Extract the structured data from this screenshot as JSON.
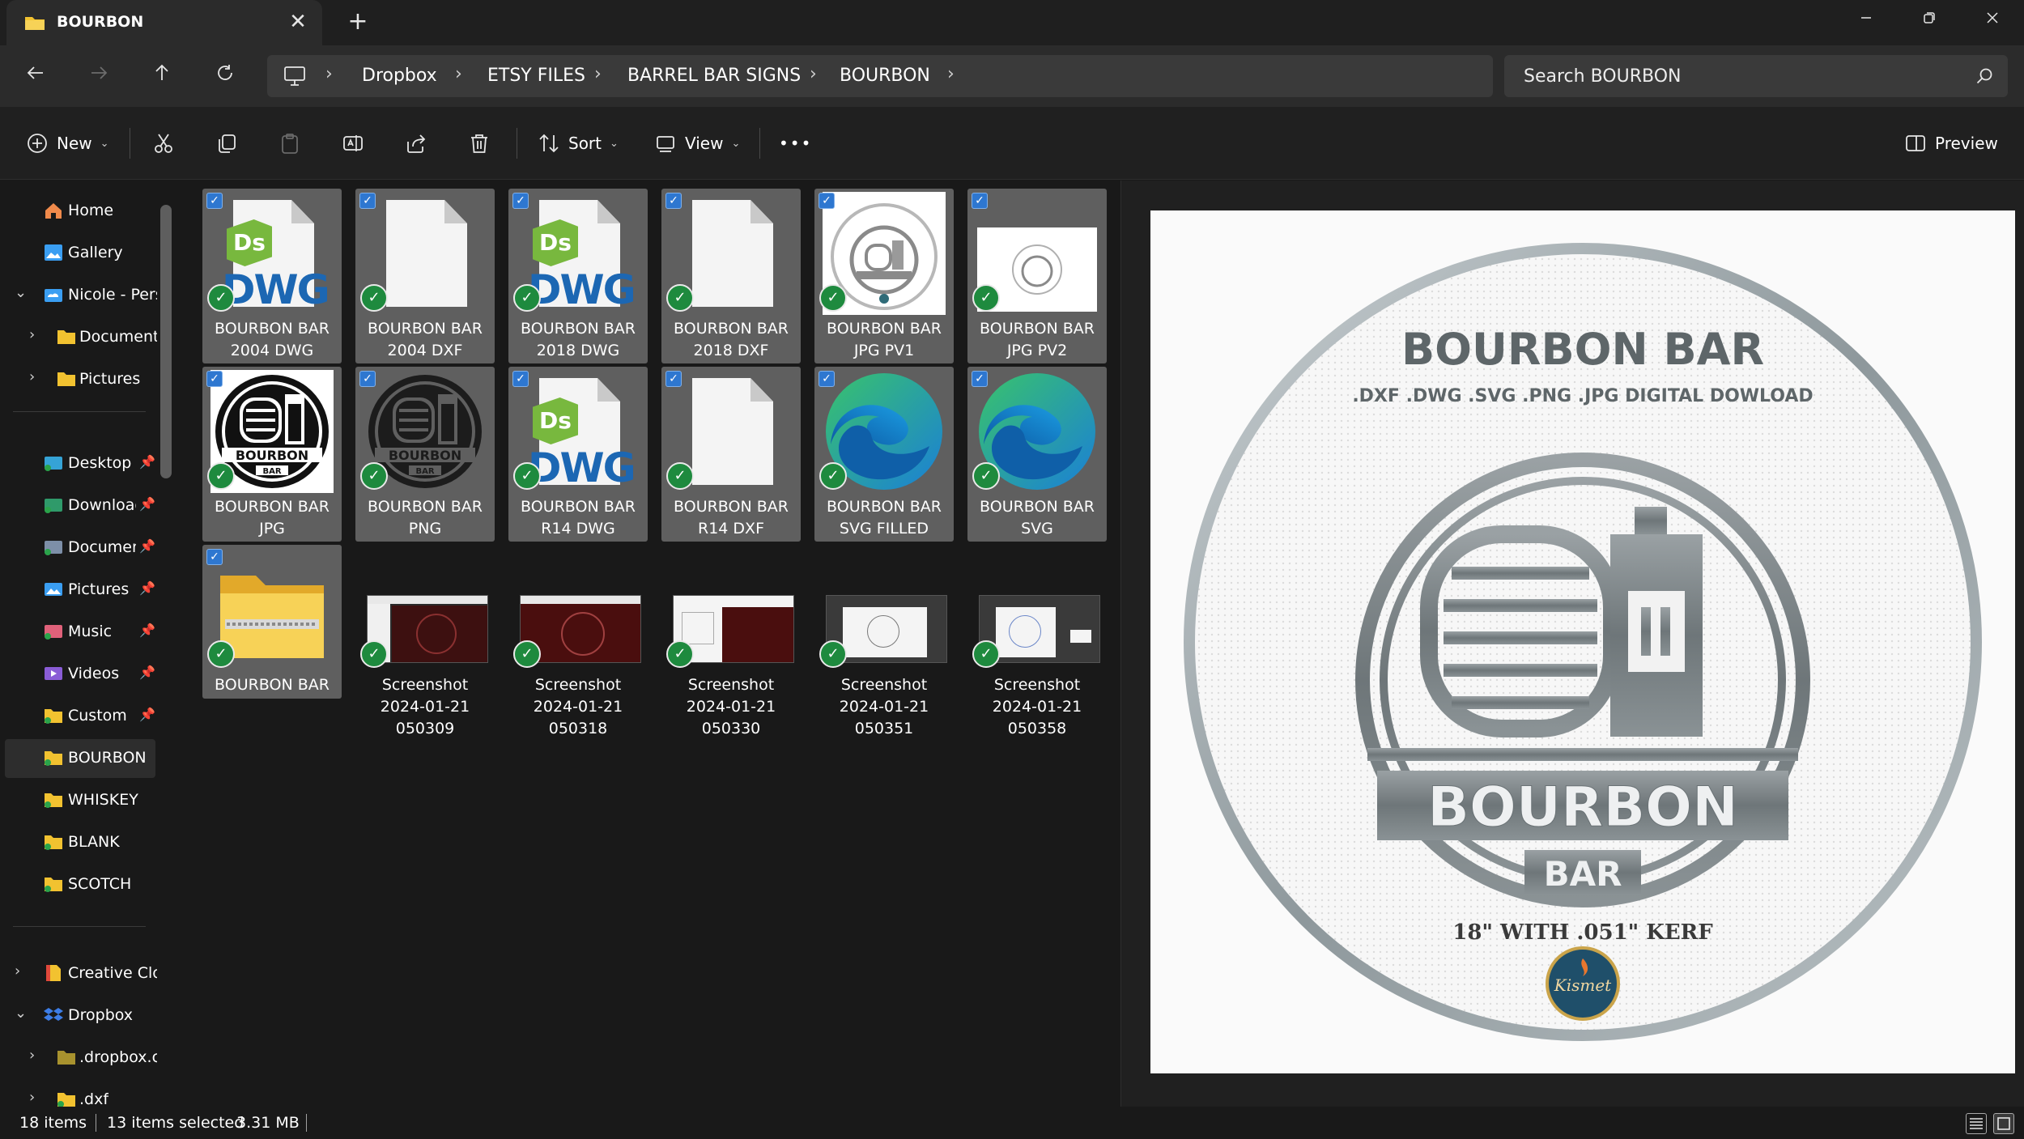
{
  "window": {
    "tab_title": "BOURBON",
    "tab_close": "✕",
    "new_tab": "+"
  },
  "breadcrumbs": [
    "Dropbox",
    "ETSY FILES",
    "BARREL BAR SIGNS",
    "BOURBON"
  ],
  "search": {
    "placeholder": "Search BOURBON"
  },
  "toolbar": {
    "new_label": "New",
    "sort_label": "Sort",
    "view_label": "View",
    "more_label": "•••",
    "preview_label": "Preview"
  },
  "sidebar": {
    "home": "Home",
    "gallery": "Gallery",
    "nicole": "Nicole - Pers",
    "documents_sub": "Documents",
    "pictures_sub": "Pictures",
    "desktop": "Desktop",
    "downloads": "Downloads",
    "documents": "Documents",
    "pictures": "Pictures",
    "music": "Music",
    "videos": "Videos",
    "custom": "Custom",
    "bourbon": "BOURBON",
    "whiskey": "WHISKEY",
    "blank": "BLANK",
    "scotch": "SCOTCH",
    "creative_cloud": "Creative Cloud",
    "dropbox": "Dropbox",
    "dropbox_cache": ".dropbox.cache",
    "dxf": ".dxf"
  },
  "files": [
    {
      "line1": "BOURBON BAR",
      "line2": "2004 DWG",
      "line3": ""
    },
    {
      "line1": "BOURBON BAR",
      "line2": "2004 DXF",
      "line3": ""
    },
    {
      "line1": "BOURBON BAR",
      "line2": "2018 DWG",
      "line3": ""
    },
    {
      "line1": "BOURBON BAR",
      "line2": "2018 DXF",
      "line3": ""
    },
    {
      "line1": "BOURBON BAR",
      "line2": "JPG PV1",
      "line3": ""
    },
    {
      "line1": "BOURBON BAR",
      "line2": "JPG PV2",
      "line3": ""
    },
    {
      "line1": "BOURBON BAR",
      "line2": "JPG",
      "line3": ""
    },
    {
      "line1": "BOURBON BAR",
      "line2": "PNG",
      "line3": ""
    },
    {
      "line1": "BOURBON BAR",
      "line2": "R14 DWG",
      "line3": ""
    },
    {
      "line1": "BOURBON BAR",
      "line2": "R14 DXF",
      "line3": ""
    },
    {
      "line1": "BOURBON BAR",
      "line2": "SVG FILLED",
      "line3": ""
    },
    {
      "line1": "BOURBON BAR",
      "line2": "SVG",
      "line3": ""
    },
    {
      "line1": "BOURBON BAR",
      "line2": "",
      "line3": ""
    },
    {
      "line1": "Screenshot",
      "line2": "2024-01-21",
      "line3": "050309"
    },
    {
      "line1": "Screenshot",
      "line2": "2024-01-21",
      "line3": "050318"
    },
    {
      "line1": "Screenshot",
      "line2": "2024-01-21",
      "line3": "050330"
    },
    {
      "line1": "Screenshot",
      "line2": "2024-01-21",
      "line3": "050351"
    },
    {
      "line1": "Screenshot",
      "line2": "2024-01-21",
      "line3": "050358"
    }
  ],
  "dwg_badge": {
    "ds": "Ds",
    "dwg": "DWG"
  },
  "preview": {
    "title": "BOURBON BAR",
    "subtitle": ".DXF .DWG .SVG .PNG .JPG DIGITAL DOWLOAD",
    "emblem_word": "BOURBON",
    "emblem_sub": "BAR",
    "size_note": "18\" WITH .051\" KERF",
    "logo_text": "Kismet"
  },
  "status": {
    "items": "18 items",
    "selected": "13 items selected",
    "size": "3.31 MB"
  },
  "colors": {
    "accent": "#2e77d0",
    "sync_green": "#1e8a3e",
    "folder_yellow": "#f2c230",
    "edge_blue": "#1a7fd8",
    "edge_green": "#39c36b"
  }
}
